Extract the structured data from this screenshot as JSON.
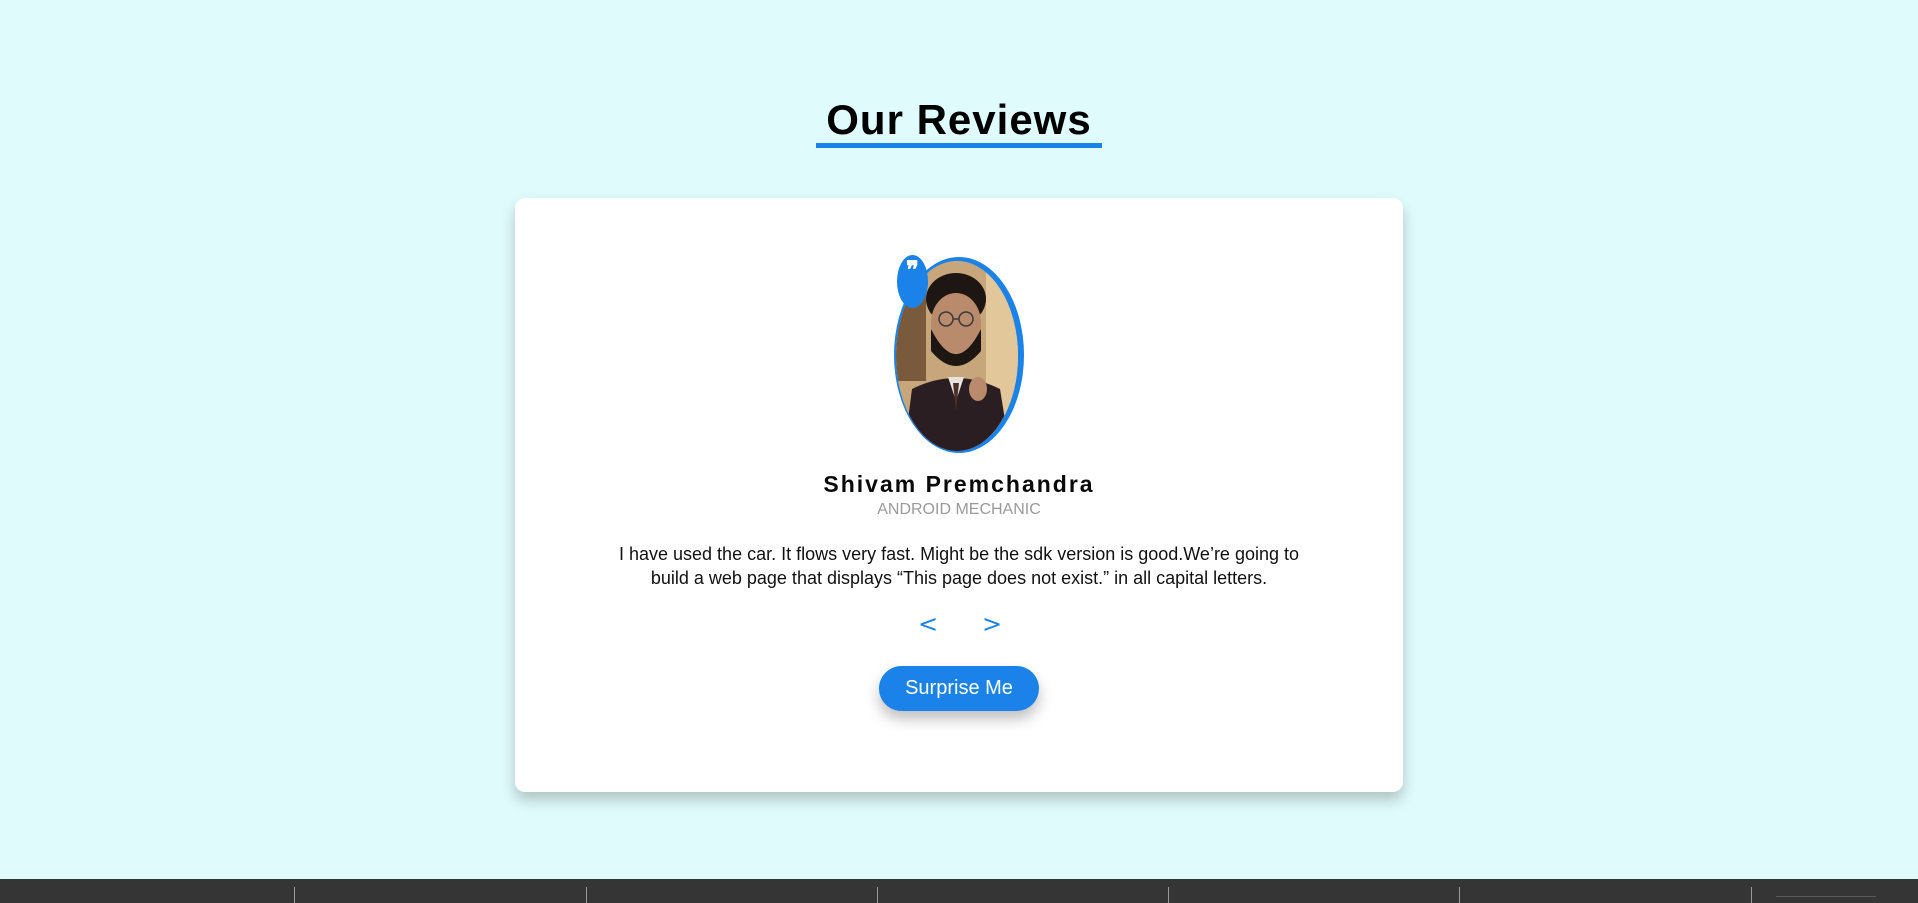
{
  "page": {
    "title": "Our Reviews"
  },
  "review": {
    "name": "Shivam Premchandra",
    "role": "ANDROID MECHANIC",
    "text": "I have used the car. It flows very fast. Might be the sdk version is good.We’re going to build a web page that displays “This page does not exist.” in all capital letters.",
    "quote_glyph": "❞",
    "avatar_icon": "person-portrait"
  },
  "controls": {
    "prev_label": "<",
    "next_label": ">",
    "surprise_label": "Surprise Me"
  },
  "colors": {
    "background": "#e0fbfc",
    "accent": "#1a82e8",
    "card": "#ffffff",
    "role_text": "#9a9a9a",
    "footer": "#353535"
  }
}
